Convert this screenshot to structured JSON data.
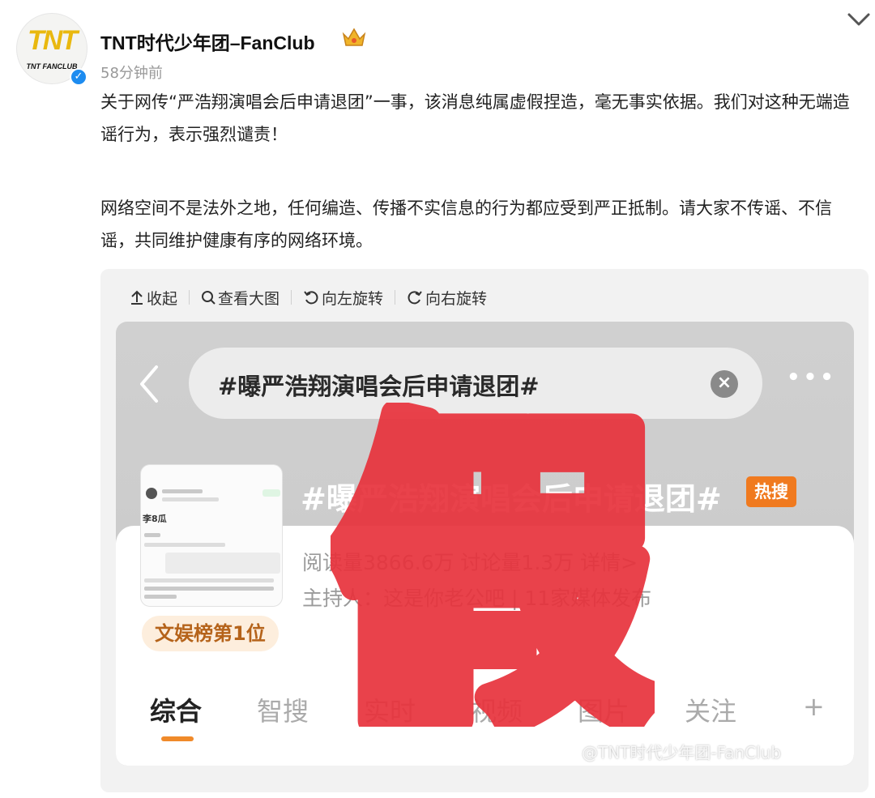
{
  "post": {
    "author": "TNT时代少年团–FanClub",
    "avatar_logo": "TNT",
    "avatar_logo_sub": "TNT FANCLUB",
    "time": "58分钟前",
    "verified_icon": "verified-icon",
    "paragraphs": [
      "关于网传“严浩翔演唱会后申请退团”一事，该消息纯属虚假捏造，毫无事实依据。我们对这种无端造谣行为，表示强烈谴责！",
      "网络空间不是法外之地，任何编造、传播不实信息的行为都应受到严正抵制。请大家不传谣、不信谣，共同维护健康有序的网络环境。"
    ]
  },
  "toolbar": {
    "collapse": "收起",
    "view_large": "查看大图",
    "rotate_left": "向左旋转",
    "rotate_right": "向右旋转"
  },
  "screenshot": {
    "search_query": "#曝严浩翔演唱会后申请退团#",
    "topic_title": "#曝严浩翔演唱会后申请退团#",
    "hot_badge": "热搜",
    "stats": "阅读量3866.6万  讨论量1.3万  详情>",
    "host": "主持人：这是你老公吧 | 11家媒体发布",
    "rank": "文娱榜第1位",
    "thumb_line": "李8瓜",
    "tabs": [
      "综合",
      "智搜",
      "实时",
      "视频",
      "图片",
      "关注"
    ],
    "tab_plus": "+",
    "stamp": "假",
    "watermark": "@TNT时代少年团-FanClub"
  },
  "colors": {
    "stamp_red": "#e8323c",
    "hot_orange": "#f07a1f",
    "verified_blue": "#1d8cf0",
    "logo_gold": "#e9b80f"
  }
}
